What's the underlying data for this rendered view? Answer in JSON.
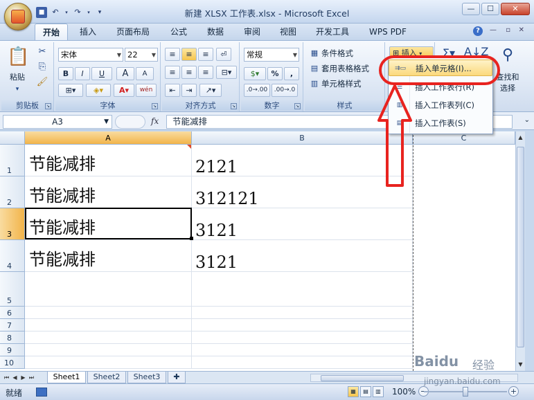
{
  "title_bar": {
    "title": "新建 XLSX 工作表.xlsx - Microsoft Excel",
    "minimize": "—",
    "maximize": "☐",
    "close": "✕",
    "qat": [
      "save-icon",
      "undo-icon",
      "redo-icon",
      "customize-icon"
    ]
  },
  "tabs": [
    "开始",
    "插入",
    "页面布局",
    "公式",
    "数据",
    "审阅",
    "视图",
    "开发工具",
    "WPS PDF"
  ],
  "tabs_active": "开始",
  "tab_controls": {
    "help": "?",
    "min": "—",
    "restore": "▫",
    "close": "✕"
  },
  "ribbon": {
    "clipboard": {
      "label": "剪贴板",
      "paste": "粘贴"
    },
    "font": {
      "label": "字体",
      "font_name": "宋体",
      "font_size": "22",
      "bold": "B",
      "italic": "I",
      "underline": "U",
      "grow": "A",
      "shrink": "A",
      "wen": "wén"
    },
    "alignment": {
      "label": "对齐方式"
    },
    "number": {
      "label": "数字",
      "format": "常规",
      "percent": "%",
      "comma": ","
    },
    "styles": {
      "label": "样式",
      "conditional": "条件格式",
      "table": "套用表格格式",
      "cell": "单元格样式"
    },
    "cells": {
      "insert": "插入"
    },
    "editing": {
      "find": "查找和",
      "select": "选择"
    }
  },
  "formula_bar": {
    "name_box": "A3",
    "fx": "fx",
    "content": "节能减排"
  },
  "grid": {
    "columns": [
      "A",
      "B",
      "C"
    ],
    "rows": [
      {
        "num": "1",
        "a": "节能减排",
        "b": "2121"
      },
      {
        "num": "2",
        "a": "节能减排",
        "b": "312121"
      },
      {
        "num": "3",
        "a": "节能减排",
        "b": "3121"
      },
      {
        "num": "4",
        "a": "节能减排",
        "b": "3121"
      },
      {
        "num": "5",
        "a": "",
        "b": ""
      },
      {
        "num": "6",
        "a": "",
        "b": ""
      },
      {
        "num": "7",
        "a": "",
        "b": ""
      },
      {
        "num": "8",
        "a": "",
        "b": ""
      },
      {
        "num": "9",
        "a": "",
        "b": ""
      },
      {
        "num": "10",
        "a": "",
        "b": ""
      }
    ],
    "selected_cell": "A3"
  },
  "insert_menu": [
    {
      "label": "插入单元格(I)...",
      "icon": "insert-cells-icon",
      "highlighted": true
    },
    {
      "label": "插入工作表行(R)",
      "icon": "insert-row-icon",
      "highlighted": false
    },
    {
      "label": "插入工作表列(C)",
      "icon": "insert-column-icon",
      "highlighted": false
    },
    {
      "label": "插入工作表(S)",
      "icon": "insert-sheet-icon",
      "highlighted": false
    }
  ],
  "sheets": [
    "Sheet1",
    "Sheet2",
    "Sheet3"
  ],
  "active_sheet": "Sheet1",
  "status": {
    "text": "就绪",
    "zoom": "100%"
  },
  "watermark": {
    "brand": "Baidu",
    "suffix": "经验",
    "url": "jingyan.baidu.com"
  },
  "colors": {
    "annotation_red": "#e8231f",
    "ribbon_bg": "#dbe6f5",
    "selected_header": "#f2b44a"
  }
}
